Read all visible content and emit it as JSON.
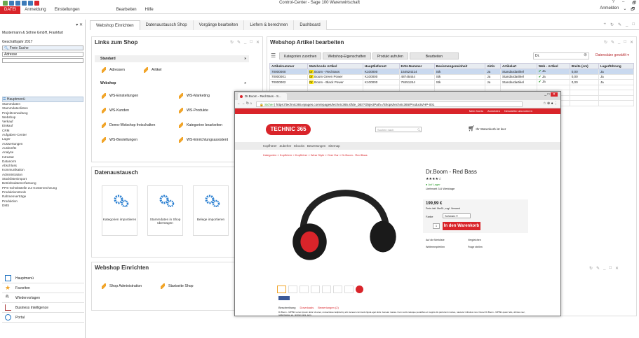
{
  "window": {
    "title": "Control-Center - Sage 100 Warenwirtschaft",
    "controls": [
      "?",
      "–",
      "🗗"
    ]
  },
  "menubar": {
    "file": "DATEI",
    "items": [
      "Anmeldung",
      "Einstellungen",
      "Bearbeiten",
      "Hilfe"
    ],
    "right": "Anmelden"
  },
  "left": {
    "company": "Mustermann & Söhne GmbH, Frankfurt",
    "year": "Geschäftsjahr 2017",
    "search_label": "Freie Suche",
    "search_field": "Adresse",
    "tree_header": "Hauptmenü",
    "tree": [
      "Stammdaten",
      "Stammdatenlisten",
      "Projektverwaltung",
      "Webshop",
      "Verkauf",
      "Einkauf",
      "CRM",
      "Aufgaben-Center",
      "Lager",
      "Auswertungen",
      "Auskünfte",
      "Analyse",
      "Intrastat",
      "Datanorm",
      "Abschluss",
      "Kommunikation",
      "Administration",
      "Stücklistenimport",
      "Betriebsdatenerfassung",
      "PPS-Schnittstelle zur Kostenrechnung",
      "Produktionstools",
      "Rahmenverträge",
      "Produktion",
      "DMS"
    ],
    "nav": [
      "Hauptmenü",
      "Favoriten",
      "Wiedervorlagen",
      "Business Intelligence",
      "Portal"
    ]
  },
  "tabs": [
    "Webshop Einrichten",
    "Datenaustausch Shop",
    "Vorgänge bearbeiten",
    "Liefern & berechnen",
    "Dashboard"
  ],
  "links_panel": {
    "title": "Links zum Shop",
    "sec_standard": "Standard",
    "standard": [
      "Adressen",
      "Artikel"
    ],
    "sec_webshop": "Webshop",
    "webshop": [
      "WS-Einstellungen",
      "WS-Marketing",
      "WS-Kunden",
      "WS-Produkte",
      "Demo-Webshop freischalten",
      "Kategorien bearbeiten",
      "WS-Bestellungen",
      "WS-Einrichtungsassistent"
    ]
  },
  "data_panel": {
    "title": "Datenaustausch",
    "tiles": [
      "Kategorien importieren",
      "Stammdaten in Shop übertragen",
      "Belege importieren"
    ]
  },
  "setup_panel": {
    "title": "Webshop Einrichten",
    "links": [
      "Shop Administration",
      "Startseite Shop"
    ]
  },
  "articles": {
    "title": "Webshop Artikel bearbeiten",
    "buttons": [
      "Kategorien zuordnen",
      "Webshop-Eigenschaften",
      "Produkt aufrufen",
      "Bearbeiten"
    ],
    "search": "Dr.",
    "filter": "Datensätze gewählt",
    "columns": [
      "Artikelnummer",
      "Matchcode Artikel",
      "Hauptlieferant",
      "EAN-Nummer",
      "Basismengeneinheit",
      "Aktiv",
      "Artikelart",
      "Web - Artikel",
      "Breite (cm)",
      "Lagerführung"
    ],
    "rows": [
      [
        "70000000",
        "Dr. Boom - Red Bass",
        "K100000",
        "154524214",
        "Stk",
        "Ja",
        "Standardartikel",
        "Ja",
        "0,00",
        "Ja"
      ],
      [
        "70000001",
        "Dr. Boom Green Power",
        "K100000",
        "48745444",
        "Stk",
        "Ja",
        "Standardartikel",
        "Ja",
        "0,00",
        "Ja"
      ],
      [
        "70000002",
        "Dr. Boom - Black Power",
        "K100000",
        "78451244",
        "Stk",
        "Ja",
        "Standardartikel",
        "Ja",
        "0,00",
        "Ja"
      ]
    ]
  },
  "browser": {
    "tab": "Dr.Boom - Red Bass - S...",
    "secure": "Sicher",
    "url": "https://technic365.epages.com/epages/technic365.sf/de_DE/?ObjectPath=/Shops/technic365/Products/HP-001",
    "topbar": [
      "Mein Konto",
      "Anmelden",
      "Newsletter abonnieren"
    ],
    "logo": "TECHNIC 365",
    "search_ph": "Suchen nach",
    "cart": "Ihr Warenkorb ist leer",
    "nav": [
      "Kopfhörer",
      "Zubehör",
      "Ebooks",
      "Bewertungen",
      "Sitemap"
    ],
    "crumb": "Kategorien » Kopfhörer » Kopfhörer » Wear Style » Over Ear » Dr.Boom - Red Bass",
    "product": "Dr.Boom - Red Bass",
    "stock": "Auf Lager",
    "delivery": "Lieferzeit 3-6 Werktage",
    "price": "199,99 €",
    "tax": "Preis inkl. MwSt., zzgl. Versand",
    "color_label": "Farbe",
    "color": "Schwarz",
    "qty": "1",
    "buy": "In den Warenkorb",
    "actions": [
      "Auf die Merkliste",
      "Vergleichen",
      "Weiterempfehlen",
      "Frage stellen"
    ],
    "tabs": [
      "Beschreibung",
      "Downloads",
      "Bewertungen (2)"
    ],
    "desc": "Dr.Boom - MP591 Lorem ipsum dolor sit amet, consectetuer adipiscing elit. Aenean commodo ligula eget dolor. Aenean massa. Cum sociis natoque penatibus et magnis dis parturient montes, nascetur ridiculus mus. Donec Dr.Boom - MP591 quam felis, ultricies nec, pellentesque eu, pretium quis, sem."
  }
}
